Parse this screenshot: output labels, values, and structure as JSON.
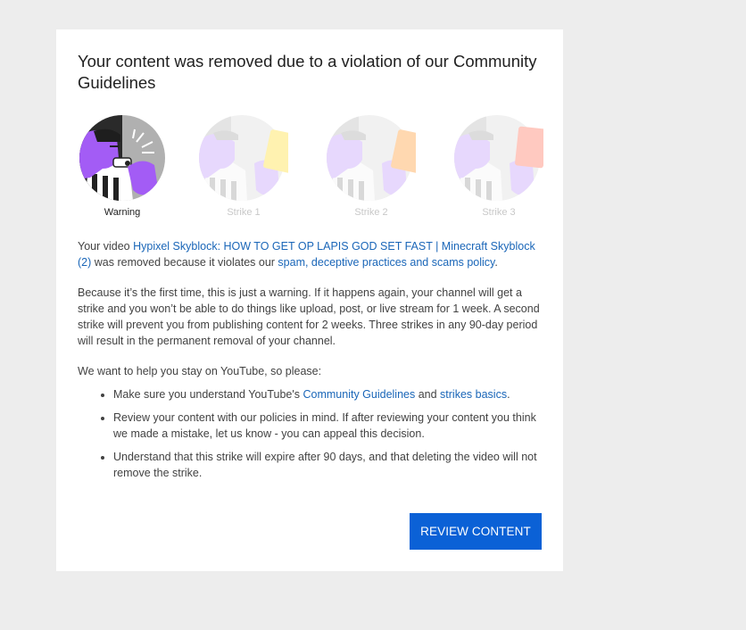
{
  "dialog": {
    "title": "Your content was removed due to a violation of our Community Guidelines",
    "strikes": [
      {
        "label": "Warning",
        "active": true,
        "card_color": "#ffffff"
      },
      {
        "label": "Strike 1",
        "active": false,
        "card_color": "#fff2b0"
      },
      {
        "label": "Strike 2",
        "active": false,
        "card_color": "#ffd8b0"
      },
      {
        "label": "Strike 3",
        "active": false,
        "card_color": "#ffc9c0"
      }
    ],
    "paragraph1": {
      "prefix": "Your video ",
      "video_title": "Hypixel Skyblock: HOW TO GET OP LAPIS GOD SET FAST | Minecraft Skyblock (2)",
      "middle": " was removed because it violates our ",
      "policy_link": "spam, deceptive practices and scams policy",
      "suffix": "."
    },
    "paragraph2": "Because it’s the first time, this is just a warning. If it happens again, your channel will get a strike and you won’t be able to do things like upload, post, or live stream for 1 week. A second strike will prevent you from publishing content for 2 weeks. Three strikes in any 90-day period will result in the permanent removal of your channel.",
    "paragraph3": "We want to help you stay on YouTube, so please:",
    "bullets": {
      "b1_prefix": "Make sure you understand YouTube's ",
      "b1_link1": "Community Guidelines",
      "b1_middle": " and ",
      "b1_link2": "strikes basics",
      "b1_suffix": ".",
      "b2": "Review your content with our policies in mind. If after reviewing your content you think we made a mistake, let us know - you can appeal this decision.",
      "b3": "Understand that this strike will expire after 90 days, and that deleting the video will not remove the strike."
    },
    "review_button": "REVIEW CONTENT"
  },
  "colors": {
    "accent": "#0b61d6",
    "link": "#1a66b8",
    "illustration_purple": "#a35cf5",
    "illustration_gray": "#9e9e9e"
  }
}
